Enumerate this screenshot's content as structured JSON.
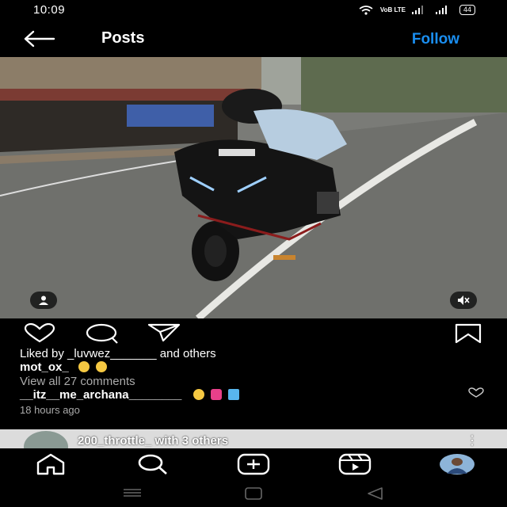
{
  "status_bar": {
    "time": "10:09",
    "network": "VoB LTE",
    "battery": "44"
  },
  "header": {
    "title": "Posts",
    "follow_label": "Follow"
  },
  "post": {
    "liked_by": "Liked by _luvwez_______ and others",
    "caption_user": "mot_ox_",
    "view_comments": "View all 27 comments",
    "comment_user": "__itz__me_archana________",
    "time_ago": "18 hours ago"
  },
  "next_post": {
    "users": "200_throttle_ with 3 others",
    "menu": "⋮"
  },
  "colors": {
    "accent": "#1a8ef0",
    "background": "#000000"
  },
  "icons": [
    "back-arrow-icon",
    "heart-icon",
    "comment-icon",
    "share-icon",
    "bookmark-icon",
    "home-icon",
    "search-icon",
    "add-icon",
    "reels-icon",
    "profile-avatar"
  ]
}
